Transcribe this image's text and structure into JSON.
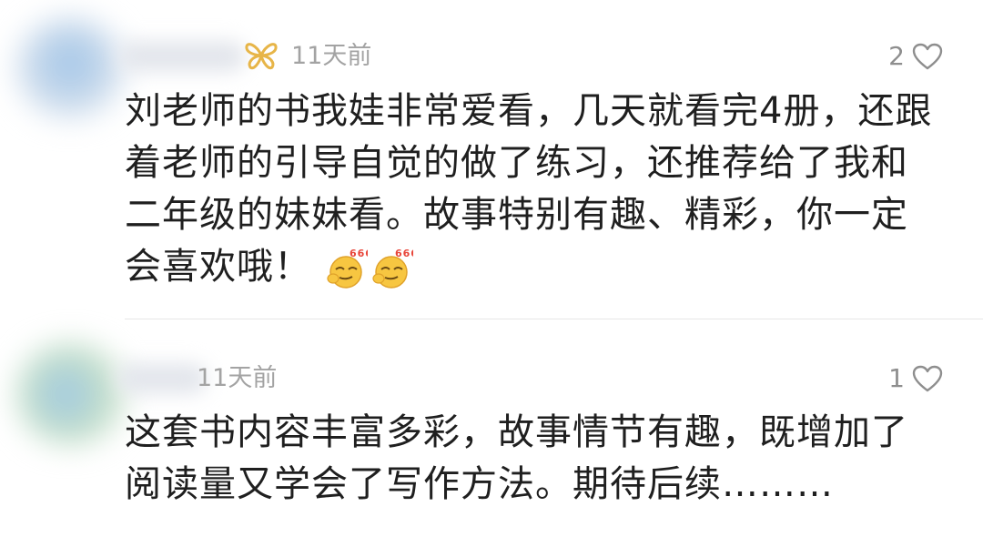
{
  "comments": [
    {
      "time": "11天前",
      "likes": "2",
      "text": "刘老师的书我娃非常爱看，几天就看完4册，还跟着老师的引导自觉的做了练习，还推荐给了我和二年级的妹妹看。故事特别有趣、精彩，你一定会喜欢哦！",
      "emojis": [
        "666",
        "666"
      ],
      "badge_icon": "butterfly-badge-icon"
    },
    {
      "time": "11天前",
      "likes": "1",
      "text": "这套书内容丰富多彩，故事情节有趣，既增加了阅读量又学会了写作方法。期待后续………"
    }
  ],
  "colors": {
    "meta_text": "#a3a3a3",
    "badge_gold": "#e7b548",
    "divider": "#e6e6e6"
  }
}
